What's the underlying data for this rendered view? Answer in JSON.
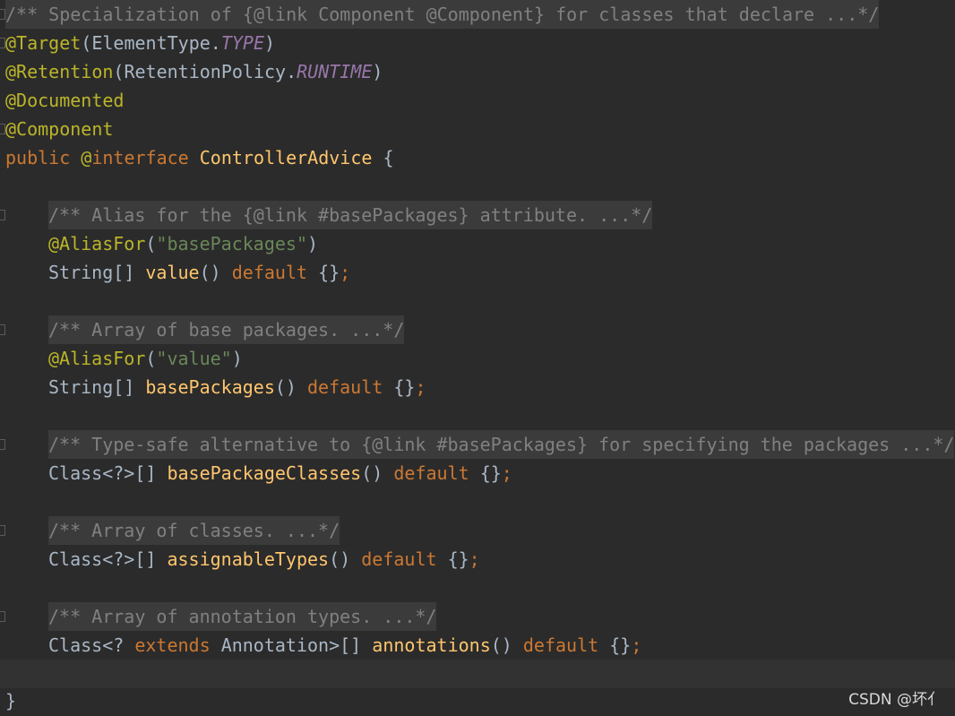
{
  "colors": {
    "background": "#2b2b2b",
    "annotation": "#bbb529",
    "keyword": "#cc7832",
    "method": "#ffc66d",
    "string": "#6a8759",
    "doc_comment": "#808080",
    "constant": "#9876aa",
    "plain": "#a9b7c6"
  },
  "code": {
    "class_doc": "/** Specialization of {@link Component @Component} for classes that declare ...*/",
    "target_ann": "@Target",
    "target_open": "(ElementType.",
    "target_const": "TYPE",
    "close_paren": ")",
    "retention_ann": "@Retention",
    "retention_open": "(RetentionPolicy.",
    "retention_const": "RUNTIME",
    "documented_ann": "@Documented",
    "component_ann": "@Component",
    "public_kw": "public",
    "at_sign": "@",
    "interface_kw": "interface",
    "class_name": "ControllerAdvice",
    "open_brace": "{",
    "value_doc": "/** Alias for the {@link #basePackages} attribute. ...*/",
    "aliasfor_ann": "@AliasFor",
    "open_paren": "(",
    "value_alias_str": "\"basePackages\"",
    "string_array_type": "String[]",
    "value_name": "value",
    "parens": "()",
    "default_kw": "default",
    "empty_braces": "{}",
    "semicolon": ";",
    "basepackages_doc": "/** Array of base packages. ...*/",
    "basepackages_alias_str": "\"value\"",
    "basepackages_name": "basePackages",
    "basepackageclasses_doc": "/** Type-safe alternative to {@link #basePackages} for specifying the packages ...*/",
    "class_array_type": "Class<?>[]",
    "basepackageclasses_name": "basePackageClasses",
    "assignabletypes_doc": "/** Array of classes. ...*/",
    "assignabletypes_name": "assignableTypes",
    "annotations_doc": "/** Array of annotation types. ...*/",
    "class_wild": "Class<?",
    "extends_kw": "extends",
    "annotation_array_type": "Annotation>[]",
    "annotations_name": "annotations",
    "close_brace": "}"
  },
  "watermark": "CSDN @坏亻"
}
